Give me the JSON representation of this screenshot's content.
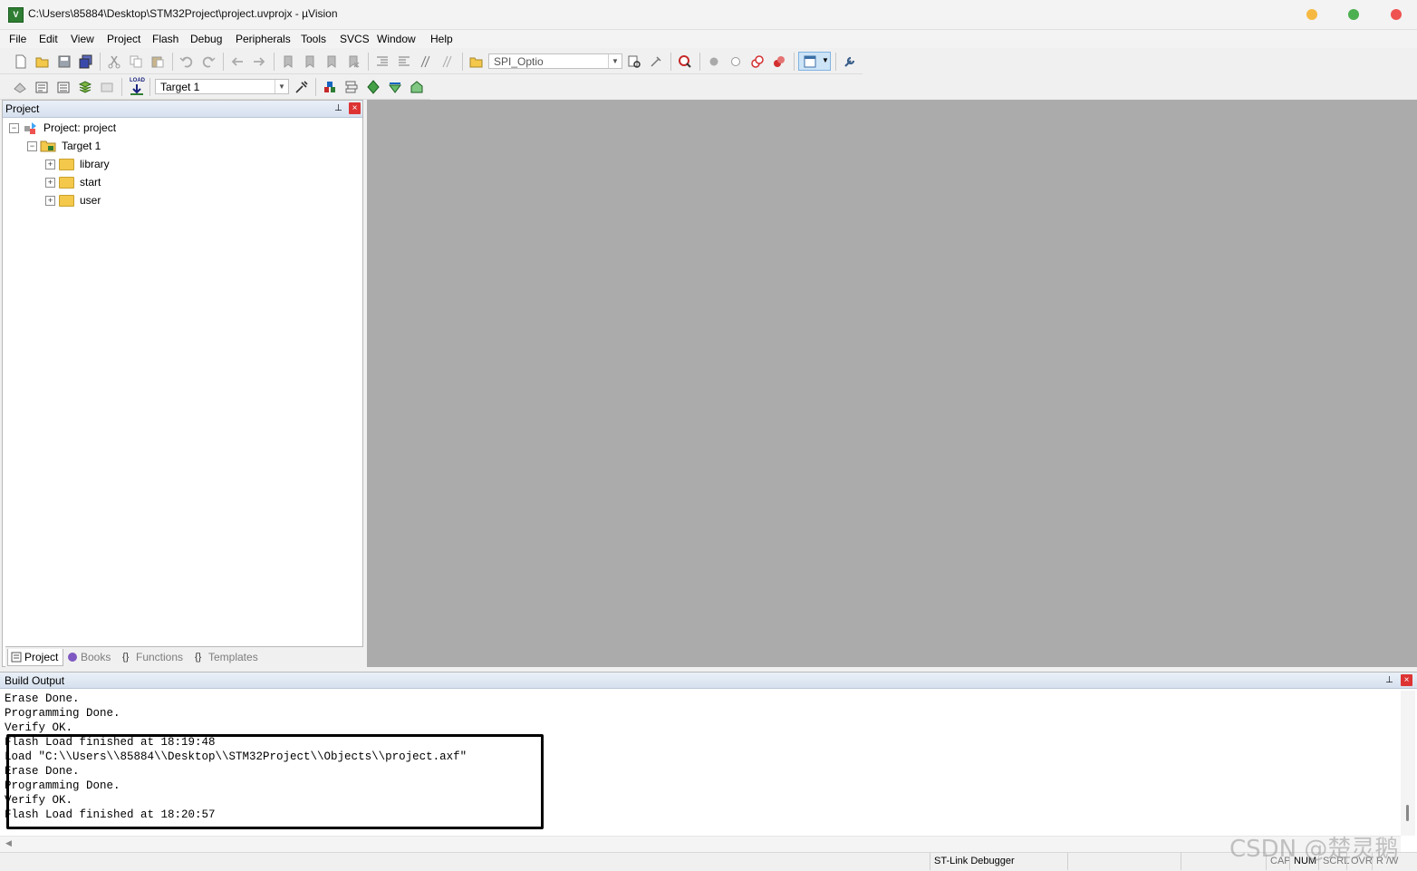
{
  "window": {
    "title": "C:\\Users\\85884\\Desktop\\STM32Project\\project.uvprojx - µVision",
    "icon_label": "V"
  },
  "menu": [
    "File",
    "Edit",
    "View",
    "Project",
    "Flash",
    "Debug",
    "Peripherals",
    "Tools",
    "SVCS",
    "Window",
    "Help"
  ],
  "toolbar1": {
    "config_combo_value": "SPI_Optio"
  },
  "toolbar2": {
    "load_label": "LOAD",
    "target_combo_value": "Target 1"
  },
  "project_pane": {
    "title": "Project",
    "tree": {
      "root": "Project: project",
      "target": "Target 1",
      "groups": [
        "library",
        "start",
        "user"
      ]
    },
    "tabs": {
      "project": "Project",
      "books": "Books",
      "functions": "Functions",
      "templates": "Templates"
    }
  },
  "build_output": {
    "title": "Build Output",
    "lines": [
      "Erase Done.",
      "Programming Done.",
      "Verify OK.",
      "Flash Load finished at 18:19:48",
      "Load \"C:\\\\Users\\\\85884\\\\Desktop\\\\STM32Project\\\\Objects\\\\project.axf\"",
      "Erase Done.",
      "Programming Done.",
      "Verify OK.",
      "Flash Load finished at 18:20:57"
    ]
  },
  "statusbar": {
    "debugger": "ST-Link Debugger",
    "cap": "CAP",
    "num": "NUM",
    "scrl": "SCRL",
    "ovr": "OVR",
    "rw": "R /W"
  },
  "watermark": "CSDN @楚灵鹅",
  "colors": {
    "editor_bg": "#ababab",
    "close_red": "#d33333",
    "minimize": "#f5b942",
    "maximize": "#4caf50",
    "close_dot": "#ef5350"
  }
}
